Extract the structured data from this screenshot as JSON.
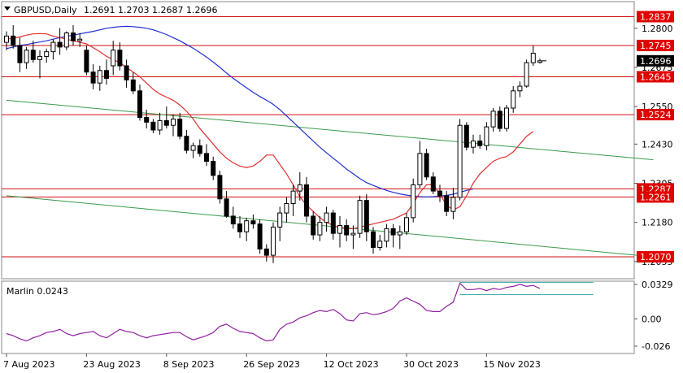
{
  "window": {
    "symbol_title": "GBPUSD,Daily",
    "ohlc_text": "1.2691 1.2703 1.2687 1.2696",
    "collapse_icon": "triangle-down-icon"
  },
  "indicator": {
    "label": "Marlin 0.0243"
  },
  "colors": {
    "bull_body": "#ffffff",
    "bear_body": "#000000",
    "candle_outline": "#000000",
    "ma_fast": "#e03030",
    "ma_slow": "#2030d0",
    "trendline": "#3a9a4a",
    "hline": "#d01010",
    "oscillator": "#9020a0",
    "osc_channel": "#40b0b0",
    "price_box_bg": "#000000",
    "price_box_text": "#ffffff",
    "level_label_bg": "#e00000",
    "level_label_text": "#ffffff"
  },
  "chart_data": [
    {
      "type": "candlestick",
      "title": "GBPUSD,Daily",
      "ylim": [
        1.2,
        1.2885
      ],
      "price_axis_ticks": [
        "1.2800",
        "1.2675",
        "1.2550",
        "1.2430",
        "1.2305",
        "1.2180",
        "1.2055"
      ],
      "current_price": "1.2696",
      "current_price_value": 1.2696,
      "horizontal_levels": [
        {
          "label": "1.2837",
          "value": 1.2837
        },
        {
          "label": "1.2745",
          "value": 1.2745
        },
        {
          "label": "1.2645",
          "value": 1.2645
        },
        {
          "label": "1.2524",
          "value": 1.2524
        },
        {
          "label": "1.2287",
          "value": 1.2287
        },
        {
          "label": "1.2261",
          "value": 1.2261
        },
        {
          "label": "1.2070",
          "value": 1.207
        }
      ],
      "date_axis_labels": [
        {
          "label": "7 Aug 2023",
          "index": 0
        },
        {
          "label": "23 Aug 2023",
          "index": 12
        },
        {
          "label": "8 Sep 2023",
          "index": 24
        },
        {
          "label": "26 Sep 2023",
          "index": 36
        },
        {
          "label": "12 Oct 2023",
          "index": 48
        },
        {
          "label": "30 Oct 2023",
          "index": 60
        },
        {
          "label": "15 Nov 2023",
          "index": 72
        }
      ],
      "candles": [
        [
          1.2755,
          1.279,
          1.273,
          1.2775
        ],
        [
          1.2775,
          1.281,
          1.2735,
          1.2745
        ],
        [
          1.2745,
          1.277,
          1.266,
          1.269
        ],
        [
          1.269,
          1.274,
          1.267,
          1.273
        ],
        [
          1.273,
          1.276,
          1.269,
          1.27
        ],
        [
          1.27,
          1.273,
          1.264,
          1.271
        ],
        [
          1.271,
          1.2735,
          1.269,
          1.2725
        ],
        [
          1.2725,
          1.2765,
          1.27,
          1.2755
        ],
        [
          1.2755,
          1.28,
          1.2715,
          1.274
        ],
        [
          1.274,
          1.279,
          1.273,
          1.2785
        ],
        [
          1.2785,
          1.281,
          1.2745,
          1.276
        ],
        [
          1.276,
          1.2785,
          1.274,
          1.2765
        ],
        [
          1.273,
          1.2745,
          1.265,
          1.266
        ],
        [
          1.266,
          1.2685,
          1.2605,
          1.2625
        ],
        [
          1.2625,
          1.268,
          1.26,
          1.2665
        ],
        [
          1.2665,
          1.27,
          1.262,
          1.264
        ],
        [
          1.268,
          1.276,
          1.265,
          1.273
        ],
        [
          1.273,
          1.2755,
          1.2665,
          1.268
        ],
        [
          1.268,
          1.27,
          1.261,
          1.2635
        ],
        [
          1.2635,
          1.266,
          1.259,
          1.26
        ],
        [
          1.26,
          1.262,
          1.2505,
          1.2515
        ],
        [
          1.2515,
          1.254,
          1.248,
          1.25
        ],
        [
          1.25,
          1.251,
          1.2465,
          1.2475
        ],
        [
          1.2475,
          1.253,
          1.246,
          1.2505
        ],
        [
          1.2505,
          1.255,
          1.248,
          1.249
        ],
        [
          1.249,
          1.2525,
          1.2455,
          1.251
        ],
        [
          1.251,
          1.253,
          1.2445,
          1.2455
        ],
        [
          1.2455,
          1.2475,
          1.24,
          1.241
        ],
        [
          1.241,
          1.2435,
          1.2385,
          1.2425
        ],
        [
          1.2425,
          1.2445,
          1.239,
          1.24
        ],
        [
          1.24,
          1.243,
          1.236,
          1.2375
        ],
        [
          1.2375,
          1.239,
          1.2315,
          1.233
        ],
        [
          1.233,
          1.2345,
          1.224,
          1.2255
        ],
        [
          1.2255,
          1.228,
          1.2195,
          1.22
        ],
        [
          1.22,
          1.223,
          1.216,
          1.2175
        ],
        [
          1.2175,
          1.22,
          1.213,
          1.215
        ],
        [
          1.215,
          1.2195,
          1.212,
          1.2185
        ],
        [
          1.2185,
          1.2205,
          1.216,
          1.2175
        ],
        [
          1.2175,
          1.219,
          1.208,
          1.2095
        ],
        [
          1.2095,
          1.211,
          1.2055,
          1.2075
        ],
        [
          1.2075,
          1.218,
          1.205,
          1.2165
        ],
        [
          1.2165,
          1.223,
          1.212,
          1.221
        ],
        [
          1.221,
          1.226,
          1.218,
          1.224
        ],
        [
          1.224,
          1.23,
          1.22,
          1.228
        ],
        [
          1.228,
          1.234,
          1.225,
          1.23
        ],
        [
          1.23,
          1.2325,
          1.218,
          1.22
        ],
        [
          1.22,
          1.2215,
          1.2125,
          1.214
        ],
        [
          1.214,
          1.22,
          1.212,
          1.218
        ],
        [
          1.218,
          1.223,
          1.215,
          1.221
        ],
        [
          1.221,
          1.222,
          1.2125,
          1.2145
        ],
        [
          1.2145,
          1.22,
          1.21,
          1.217
        ],
        [
          1.217,
          1.219,
          1.212,
          1.214
        ],
        [
          1.214,
          1.217,
          1.2095,
          1.2145
        ],
        [
          1.2145,
          1.2265,
          1.213,
          1.225
        ],
        [
          1.225,
          1.227,
          1.212,
          1.215
        ],
        [
          1.215,
          1.2165,
          1.208,
          1.21
        ],
        [
          1.21,
          1.214,
          1.209,
          1.212
        ],
        [
          1.212,
          1.2175,
          1.21,
          1.216
        ],
        [
          1.216,
          1.2175,
          1.21,
          1.214
        ],
        [
          1.214,
          1.217,
          1.2095,
          1.215
        ],
        [
          1.215,
          1.221,
          1.214,
          1.2195
        ],
        [
          1.2195,
          1.232,
          1.218,
          1.23
        ],
        [
          1.23,
          1.244,
          1.229,
          1.24
        ],
        [
          1.24,
          1.2415,
          1.2315,
          1.2325
        ],
        [
          1.2325,
          1.234,
          1.227,
          1.228
        ],
        [
          1.228,
          1.23,
          1.2245,
          1.2265
        ],
        [
          1.2265,
          1.228,
          1.22,
          1.2215
        ],
        [
          1.2215,
          1.229,
          1.219,
          1.226
        ],
        [
          1.226,
          1.251,
          1.225,
          1.249
        ],
        [
          1.249,
          1.25,
          1.241,
          1.242
        ],
        [
          1.242,
          1.246,
          1.24,
          1.244
        ],
        [
          1.244,
          1.246,
          1.2415,
          1.2425
        ],
        [
          1.2425,
          1.25,
          1.241,
          1.2485
        ],
        [
          1.2485,
          1.2545,
          1.247,
          1.2535
        ],
        [
          1.2535,
          1.255,
          1.247,
          1.248
        ],
        [
          1.248,
          1.2555,
          1.247,
          1.2545
        ],
        [
          1.2545,
          1.2615,
          1.253,
          1.26
        ],
        [
          1.26,
          1.263,
          1.258,
          1.2615
        ],
        [
          1.2615,
          1.27,
          1.261,
          1.269
        ],
        [
          1.269,
          1.2745,
          1.268,
          1.272
        ],
        [
          1.2691,
          1.2703,
          1.2687,
          1.2696
        ]
      ],
      "ma_fast": [
        1.2765,
        1.2768,
        1.2772,
        1.2778,
        1.2782,
        1.2783,
        1.2782,
        1.2775,
        1.277,
        1.2765,
        1.276,
        1.2755,
        1.275,
        1.2738,
        1.2725,
        1.271,
        1.27,
        1.269,
        1.2675,
        1.266,
        1.2645,
        1.2625,
        1.2605,
        1.259,
        1.258,
        1.257,
        1.2555,
        1.2535,
        1.251,
        1.248,
        1.2455,
        1.243,
        1.2405,
        1.2385,
        1.237,
        1.236,
        1.2355,
        1.236,
        1.2375,
        1.2395,
        1.2395,
        1.2365,
        1.2335,
        1.23,
        1.2262,
        1.2235,
        1.2215,
        1.2195,
        1.218,
        1.217,
        1.2163,
        1.216,
        1.216,
        1.2165,
        1.217,
        1.2175,
        1.218,
        1.2185,
        1.219,
        1.22,
        1.221,
        1.224,
        1.2275,
        1.23,
        1.23,
        1.227,
        1.2235,
        1.222,
        1.223,
        1.2265,
        1.2305,
        1.2335,
        1.2355,
        1.2375,
        1.2385,
        1.239,
        1.2405,
        1.243,
        1.2455,
        1.247
      ],
      "ma_slow": [
        1.2735,
        1.274,
        1.2745,
        1.2748,
        1.2752,
        1.2756,
        1.276,
        1.2765,
        1.277,
        1.2774,
        1.2778,
        1.2782,
        1.2786,
        1.279,
        1.2795,
        1.28,
        1.2803,
        1.2805,
        1.2806,
        1.2805,
        1.2803,
        1.28,
        1.2795,
        1.2788,
        1.278,
        1.277,
        1.276,
        1.2748,
        1.2736,
        1.2722,
        1.2708,
        1.2692,
        1.2675,
        1.2657,
        1.264,
        1.2625,
        1.261,
        1.2595,
        1.2582,
        1.257,
        1.2557,
        1.254,
        1.252,
        1.25,
        1.248,
        1.246,
        1.244,
        1.242,
        1.2402,
        1.2385,
        1.2368,
        1.235,
        1.2335,
        1.232,
        1.2307,
        1.2298,
        1.229,
        1.2282,
        1.2276,
        1.2271,
        1.2267,
        1.2264,
        1.2262,
        1.2261,
        1.2262,
        1.2264,
        1.2266,
        1.227,
        1.2276,
        1.2282,
        1.2287
      ],
      "ma_slow_start_index": 0,
      "trendlines": [
        {
          "from": {
            "index": 0,
            "value": 1.257
          },
          "to": {
            "index": 97,
            "value": 1.238
          }
        },
        {
          "from": {
            "index": 0,
            "value": 1.2265
          },
          "to": {
            "index": 97,
            "value": 1.207
          }
        }
      ]
    },
    {
      "type": "line",
      "title": "Marlin 0.0243",
      "ylim": [
        -0.033,
        0.036
      ],
      "axis_ticks": [
        "0.0329",
        "0.00",
        "-0.026"
      ],
      "series": [
        {
          "name": "Marlin",
          "values": [
            -0.014,
            -0.016,
            -0.019,
            -0.021,
            -0.018,
            -0.016,
            -0.013,
            -0.012,
            -0.01,
            -0.014,
            -0.016,
            -0.014,
            -0.013,
            -0.012,
            -0.016,
            -0.018,
            -0.014,
            -0.01,
            -0.012,
            -0.013,
            -0.016,
            -0.018,
            -0.016,
            -0.015,
            -0.014,
            -0.013,
            -0.013,
            -0.017,
            -0.02,
            -0.018,
            -0.016,
            -0.013,
            -0.007,
            -0.005,
            -0.009,
            -0.012,
            -0.013,
            -0.014,
            -0.018,
            -0.021,
            -0.02,
            -0.01,
            -0.005,
            -0.003,
            0.001,
            0.003,
            0.006,
            0.008,
            0.007,
            0.009,
            0.005,
            -0.001,
            -0.002,
            0.005,
            0.006,
            0.004,
            0.005,
            0.007,
            0.01,
            0.017,
            0.02,
            0.017,
            0.014,
            0.008,
            0.007,
            0.007,
            0.012,
            0.016,
            0.034,
            0.028,
            0.028,
            0.029,
            0.027,
            0.029,
            0.028,
            0.03,
            0.031,
            0.033,
            0.031,
            0.032,
            0.029
          ]
        }
      ],
      "channel": {
        "upper": 0.0348,
        "lower": 0.0232,
        "from_index": 68,
        "to_index": 88
      }
    }
  ]
}
